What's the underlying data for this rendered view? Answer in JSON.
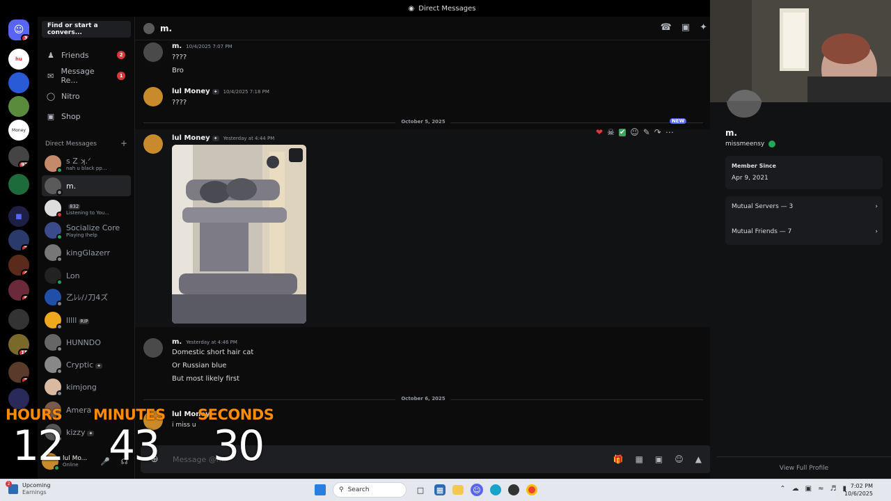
{
  "window": {
    "title": "Direct Messages"
  },
  "sidebar": {
    "search_placeholder": "Find or start a convers...",
    "nav": [
      {
        "label": "Friends",
        "badge": "2"
      },
      {
        "label": "Message Re...",
        "badge": "1"
      },
      {
        "label": "Nitro"
      },
      {
        "label": "Shop"
      }
    ],
    "dm_header": "Direct Messages",
    "dm_add": "+",
    "dms": [
      {
        "name": "ꜱ Z ʞ.ᐟ",
        "sub": "nah u black pp..."
      },
      {
        "name": "m."
      },
      {
        "name": "",
        "tag": "832",
        "sub": "Listening to You..."
      },
      {
        "name": "Socialize Core",
        "sub": "Playing Ihelp"
      },
      {
        "name": "kingGlazerr"
      },
      {
        "name": "Lon"
      },
      {
        "name": "乙ﾚﾚ/ﾉ刀4ズ"
      },
      {
        "name": "lllll",
        "tag": "RIP"
      },
      {
        "name": "HUNNDO"
      },
      {
        "name": "Cryptic",
        "tag": "✦"
      },
      {
        "name": "kimjong"
      },
      {
        "name": "Amera"
      },
      {
        "name": "kizzy",
        "tag": "✦"
      }
    ],
    "user": {
      "name": "lul Mo...",
      "status": "Online"
    }
  },
  "rail": {
    "badges": [
      "3",
      "97",
      "2",
      "4",
      "5",
      "15",
      "7"
    ]
  },
  "chat": {
    "header_name": "m.",
    "messages": [
      {
        "author": "m.",
        "time": "10/4/2025 7:07 PM",
        "lines": [
          "????",
          "Bro"
        ]
      },
      {
        "author": "lul Money",
        "time": "10/4/2025 7:18 PM",
        "lines": [
          "????"
        ]
      },
      {
        "author": "lul Money",
        "time": "Yesterday at 4:44 PM",
        "lines": []
      },
      {
        "author": "m.",
        "time": "Yesterday at 4:46 PM",
        "lines": [
          "Domestic short hair cat",
          "Or Russian blue",
          "But most likely first"
        ]
      },
      {
        "author": "lul Money",
        "time": "",
        "lines": [
          "i miss u"
        ]
      }
    ],
    "dividers": [
      "October 5, 2025",
      "October 6, 2025"
    ],
    "new_label": "NEW",
    "composer_placeholder": "Message @m."
  },
  "profile": {
    "display_name": "m.",
    "username": "missmeensy",
    "member_since_label": "Member Since",
    "member_since": "Apr 9, 2021",
    "mutual_servers": "Mutual Servers — 3",
    "mutual_friends": "Mutual Friends — 7",
    "footer": "View Full Profile"
  },
  "overlay_timer": {
    "hours_label": "HOURS",
    "minutes_label": "MINUTES",
    "seconds_label": "SECONDS",
    "hours": "12",
    "minutes": "43",
    "seconds": "30"
  },
  "taskbar": {
    "weather_title": "Upcoming",
    "weather_sub": "Earnings",
    "weather_badge": "2",
    "search": "Search",
    "time": "7:02 PM",
    "date": "10/6/2025"
  },
  "colors": {
    "brand": "#5865f2",
    "danger": "#da373c",
    "online": "#23a55a",
    "timer_label": "#ff8c00"
  }
}
